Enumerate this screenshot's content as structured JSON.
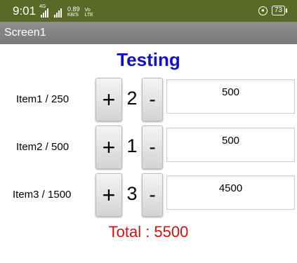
{
  "status_bar": {
    "time": "9:01",
    "signal1_label": "4G",
    "net_speed_value": "0.89",
    "net_speed_unit": "KB/S",
    "volte_top": "Vo",
    "volte_bottom": "LTE",
    "battery": "73"
  },
  "app_bar": {
    "title": "Screen1"
  },
  "page": {
    "title": "Testing"
  },
  "items": [
    {
      "label": "Item1 / 250",
      "plus": "+",
      "qty": "2",
      "minus": "-",
      "amount": "500"
    },
    {
      "label": "Item2 / 500",
      "plus": "+",
      "qty": "1",
      "minus": "-",
      "amount": "500"
    },
    {
      "label": "Item3 / 1500",
      "plus": "+",
      "qty": "3",
      "minus": "-",
      "amount": "4500"
    }
  ],
  "total": "Total : 5500",
  "colors": {
    "status_bar": "#5a6a26",
    "app_bar": "#838383",
    "title": "#1010c8",
    "total": "#d01010"
  }
}
